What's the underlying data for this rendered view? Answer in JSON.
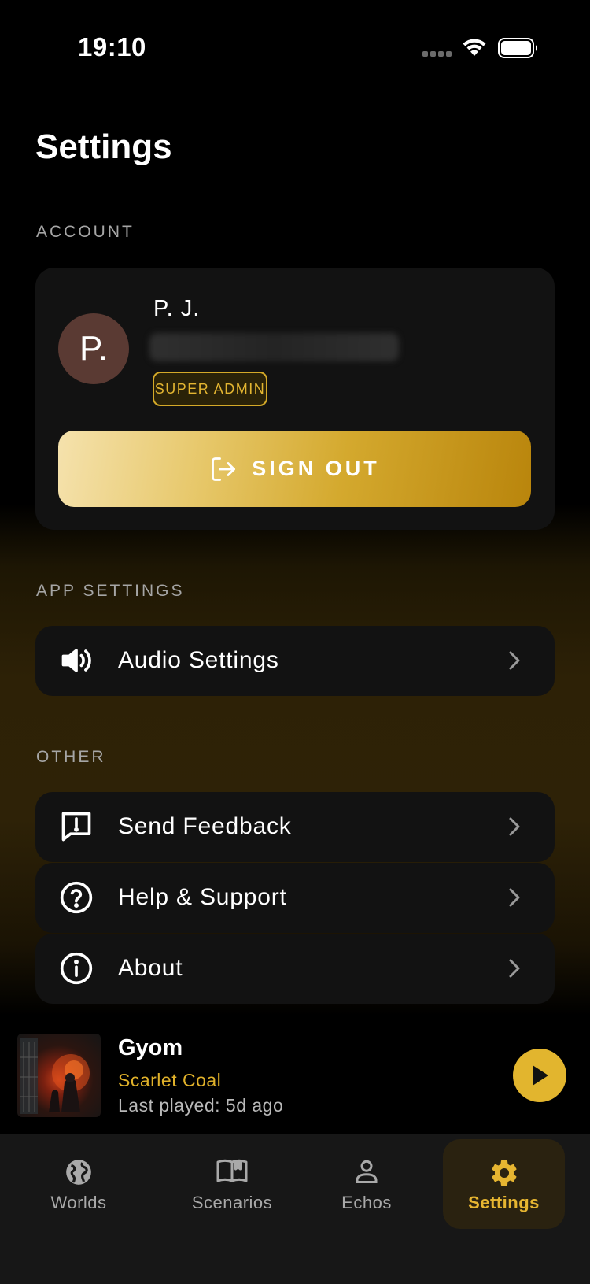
{
  "status_bar": {
    "time": "19:10"
  },
  "page": {
    "title": "Settings"
  },
  "account": {
    "section_label": "ACCOUNT",
    "avatar_initial": "P.",
    "name": "P. J.",
    "role_badge": "SUPER ADMIN",
    "sign_out_label": "SIGN OUT"
  },
  "app_settings": {
    "section_label": "APP SETTINGS",
    "items": [
      {
        "label": "Audio Settings",
        "icon": "speaker-icon"
      }
    ]
  },
  "other": {
    "section_label": "OTHER",
    "items": [
      {
        "label": "Send Feedback",
        "icon": "feedback-icon"
      },
      {
        "label": "Help & Support",
        "icon": "help-icon"
      },
      {
        "label": "About",
        "icon": "info-icon"
      }
    ]
  },
  "now_playing": {
    "title": "Gyom",
    "subtitle": "Scarlet Coal",
    "meta": "Last played: 5d ago"
  },
  "tabs": [
    {
      "label": "Worlds",
      "icon": "globe-icon",
      "active": false
    },
    {
      "label": "Scenarios",
      "icon": "book-icon",
      "active": false
    },
    {
      "label": "Echos",
      "icon": "person-icon",
      "active": false
    },
    {
      "label": "Settings",
      "icon": "gear-icon",
      "active": true
    }
  ],
  "colors": {
    "accent": "#e2b52e",
    "card_bg": "#121212",
    "tabbar_bg": "#171717",
    "avatar_bg": "#5a3a33"
  }
}
